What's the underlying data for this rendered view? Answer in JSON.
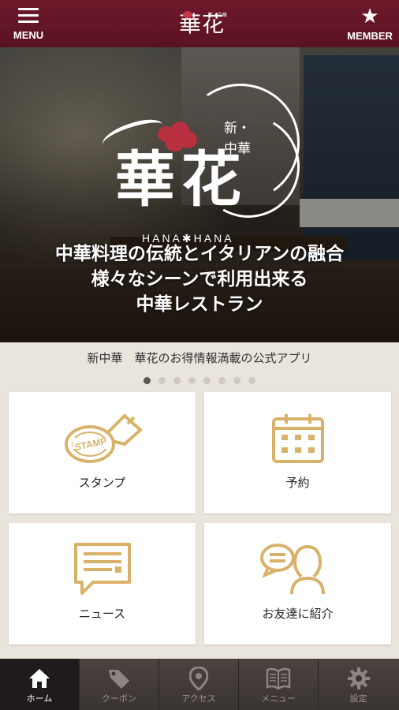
{
  "header": {
    "menu_label": "MENU",
    "member_label": "MEMBER",
    "logo_text": "華花",
    "logo_sub": "新・中華"
  },
  "hero": {
    "logo_main": "華花",
    "logo_sub_line1": "新・",
    "logo_sub_line2": "中華",
    "logo_romaji": "HANA✱HANA",
    "tagline_line1": "中華料理の伝統とイタリアンの融合",
    "tagline_line2": "様々なシーンで利用出来る",
    "tagline_line3": "中華レストラン"
  },
  "caption": "新中華　華花のお得情報満載の公式アプリ",
  "carousel": {
    "total": 8,
    "active_index": 0
  },
  "tiles": [
    {
      "label": "スタンプ",
      "icon": "stamp-icon",
      "stamp_text": "STAMP"
    },
    {
      "label": "予約",
      "icon": "calendar-icon"
    },
    {
      "label": "ニュース",
      "icon": "news-icon"
    },
    {
      "label": "お友達に紹介",
      "icon": "friend-icon"
    }
  ],
  "nav": [
    {
      "label": "ホーム",
      "icon": "home-icon",
      "active": true
    },
    {
      "label": "クーポン",
      "icon": "coupon-icon",
      "active": false
    },
    {
      "label": "アクセス",
      "icon": "map-pin-icon",
      "active": false
    },
    {
      "label": "メニュー",
      "icon": "book-icon",
      "active": false
    },
    {
      "label": "設定",
      "icon": "gear-icon",
      "active": false
    }
  ],
  "colors": {
    "header": "#5a1220",
    "accent_gold": "#d9b26a",
    "nav_bg": "#3a3432",
    "page_bg": "#e9e4dc"
  }
}
